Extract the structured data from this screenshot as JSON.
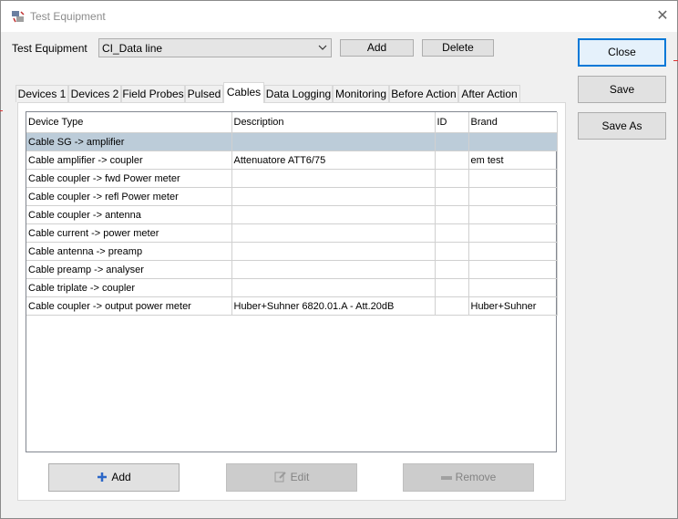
{
  "window": {
    "title": "Test Equipment",
    "close_glyph": "✕"
  },
  "equipment": {
    "label": "Test Equipment",
    "selected": "CI_Data line"
  },
  "buttons": {
    "add": "Add",
    "delete": "Delete",
    "close": "Close",
    "save": "Save",
    "save_as": "Save As"
  },
  "tabs": [
    {
      "label": "Devices 1"
    },
    {
      "label": "Devices 2"
    },
    {
      "label": "Field Probes"
    },
    {
      "label": "Pulsed"
    },
    {
      "label": "Cables"
    },
    {
      "label": "Data Logging"
    },
    {
      "label": "Monitoring"
    },
    {
      "label": "Before Action"
    },
    {
      "label": "After Action"
    }
  ],
  "active_tab": "Cables",
  "table": {
    "columns": [
      "Device Type",
      "Description",
      "ID",
      "Brand"
    ],
    "rows": [
      [
        "Cable SG -> amplifier",
        "",
        "",
        ""
      ],
      [
        "Cable amplifier -> coupler",
        "Attenuatore ATT6/75",
        "",
        "em test"
      ],
      [
        "Cable coupler -> fwd Power meter",
        "",
        "",
        ""
      ],
      [
        "Cable coupler -> refl Power meter",
        "",
        "",
        ""
      ],
      [
        "Cable coupler -> antenna",
        "",
        "",
        ""
      ],
      [
        "Cable current -> power meter",
        "",
        "",
        ""
      ],
      [
        "Cable antenna -> preamp",
        "",
        "",
        ""
      ],
      [
        "Cable preamp -> analyser",
        "",
        "",
        ""
      ],
      [
        "Cable triplate -> coupler",
        "",
        "",
        ""
      ],
      [
        "Cable coupler -> output power meter",
        "Huber+Suhner 6820.01.A - Att.20dB",
        "",
        "Huber+Suhner"
      ]
    ]
  },
  "grid_buttons": {
    "add": "Add",
    "edit": "Edit",
    "remove": "Remove"
  },
  "colors": {
    "accent": "#0078d7",
    "selection": "#bcccd9"
  }
}
